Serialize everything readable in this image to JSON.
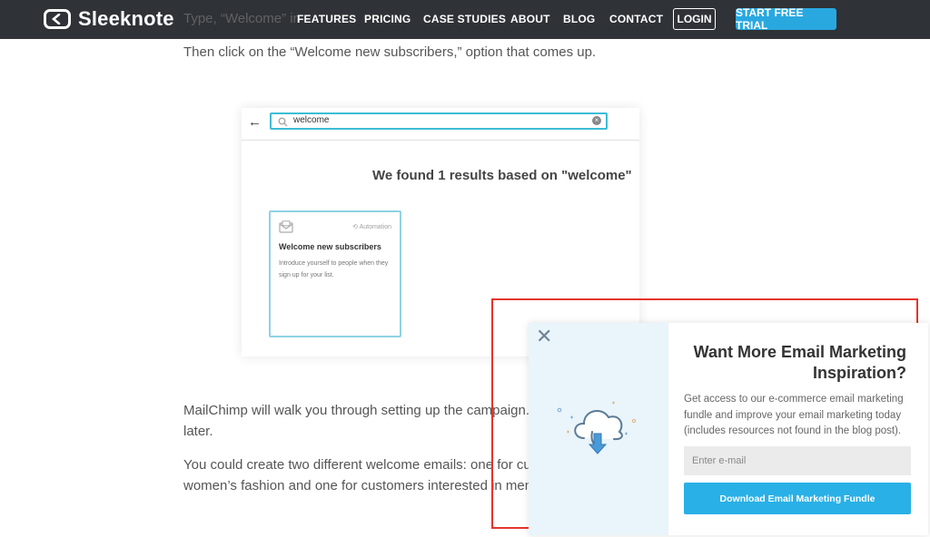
{
  "brand": {
    "name": "Sleeknote",
    "accent": "#29a8e0",
    "nav_bg": "#2f3236"
  },
  "nav": {
    "peek_text": "Type, “Welcome” in",
    "items": [
      "FEATURES",
      "PRICING",
      "CASE STUDIES",
      "ABOUT",
      "BLOG",
      "CONTACT"
    ],
    "login": "LOGIN",
    "cta": "START FREE TRIAL"
  },
  "article": {
    "p1": "Then click on the “Welcome new subscribers,” option that comes up.",
    "p2_line1": "MailChimp will walk you through setting up the campaign. Give",
    "p2_line2": "later.",
    "p3_line1": "You could create two different welcome emails: one for custom",
    "p3_line2": "women’s fashion and one for customers interested in men’s fas"
  },
  "embedded": {
    "search_value": "welcome",
    "results_title": "We found 1 results based on \"welcome\"",
    "card_tag": "Automation",
    "card_title": "Welcome new subscribers",
    "card_desc": "Introduce yourself to people when they sign up for your list."
  },
  "popup": {
    "title_line1": "Want More Email Marketing",
    "title_line2": "Inspiration?",
    "description": "Get access to our e-commerce email marketing fundle and improve your email marketing today (includes resources not found in the blog post).",
    "email_placeholder": "Enter e-mail",
    "button": "Download Email Marketing Fundle",
    "highlight_color": "#e5342b"
  }
}
